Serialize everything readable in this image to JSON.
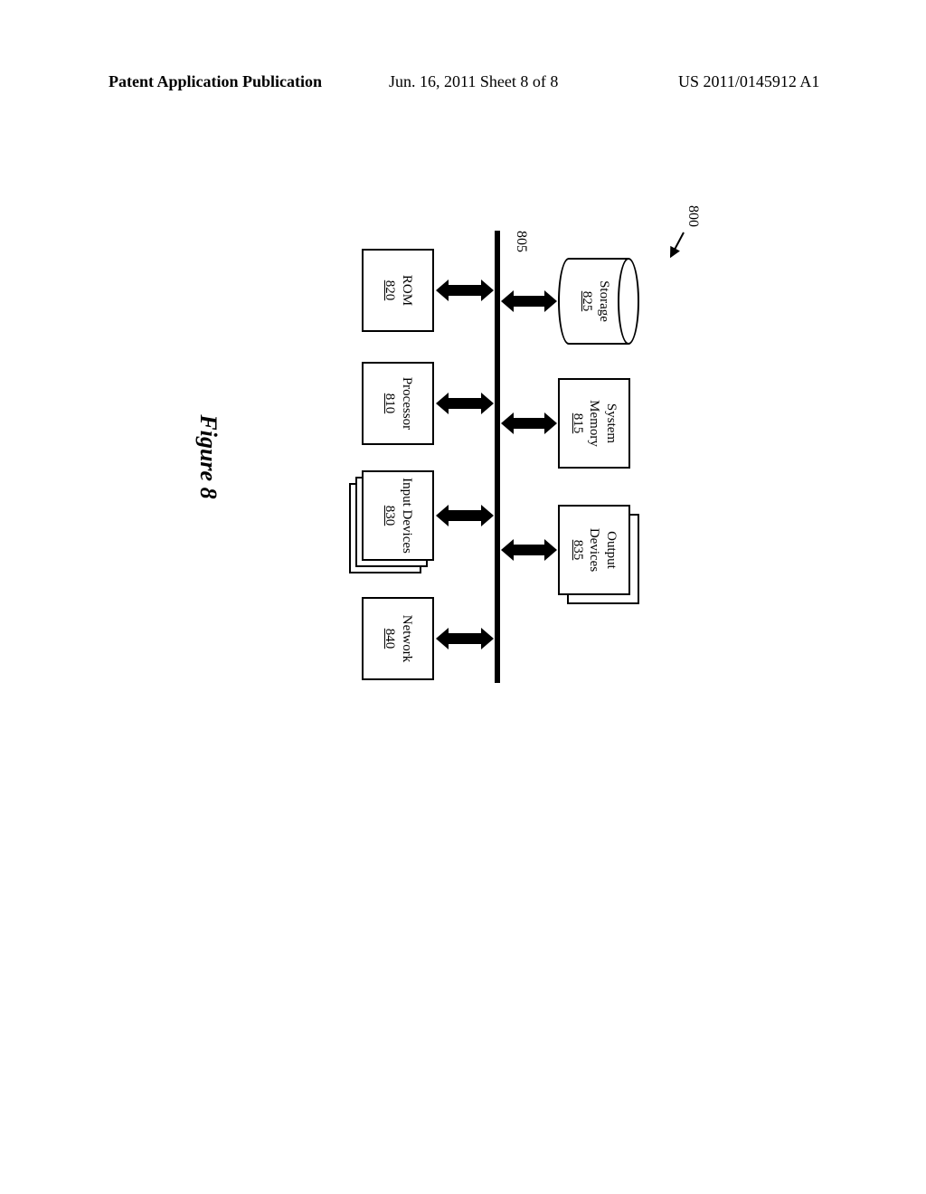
{
  "header": {
    "left": "Patent Application Publication",
    "center": "Jun. 16, 2011  Sheet 8 of 8",
    "right": "US 2011/0145912 A1"
  },
  "figure": {
    "caption": "Figure 8",
    "system_label": "800",
    "bus_label": "805",
    "blocks": {
      "storage": {
        "label": "Storage",
        "num": "825"
      },
      "system_memory": {
        "label": "System\nMemory",
        "num": "815"
      },
      "output_devices": {
        "label": "Output\nDevices",
        "num": "835"
      },
      "rom": {
        "label": "ROM",
        "num": "820"
      },
      "processor": {
        "label": "Processor",
        "num": "810"
      },
      "input_devices": {
        "label": "Input Devices",
        "num": "830"
      },
      "network": {
        "label": "Network",
        "num": "840"
      }
    }
  }
}
